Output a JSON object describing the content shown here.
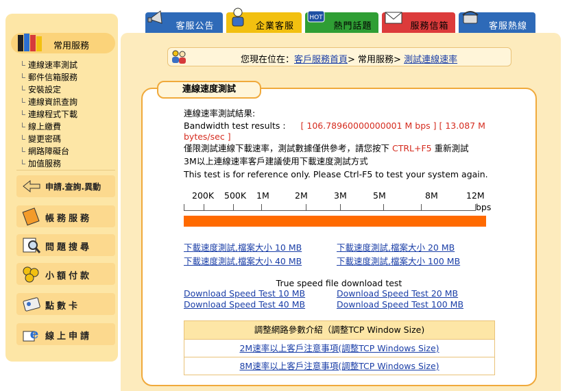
{
  "tabs": [
    {
      "label": "客服公告",
      "icon": "megaphone-icon",
      "color": "#2e6ab8"
    },
    {
      "label": "企業客服",
      "icon": "person-icon",
      "color": "#f2c010"
    },
    {
      "label": "熱門話題",
      "icon": "hot-icon",
      "color": "#2f9e34"
    },
    {
      "label": "服務信箱",
      "icon": "mail-icon",
      "color": "#dc3b3b"
    },
    {
      "label": "客服熱線",
      "icon": "telephone-icon",
      "color": "#2e6ab8"
    }
  ],
  "sidebar": {
    "heading": "常用服務",
    "items": [
      "連線速率測試",
      "郵件信箱服務",
      "安裝設定",
      "連線資訊查詢",
      "連線程式下載",
      "線上繳費",
      "變更密碼",
      "網路障礙台",
      "加值服務"
    ],
    "buttons": [
      "申請.查詢.異動",
      "帳務服務",
      "問題搜尋",
      "小額付款",
      "點數卡",
      "線上申請"
    ]
  },
  "breadcrumb": {
    "prefix": "您現在位在：",
    "home": "客戶服務首頁",
    "sep1": "> 常用服務> ",
    "current": "測試連線速率"
  },
  "card": {
    "title": "連線速度測試",
    "result_label": "連線速率測試結果:",
    "bandwidth_label": "Bandwidth test results :",
    "result_line1": "[ 106.78960000000001 M bps ] [ 13.087 M",
    "result_line2": "bytes/sec ]",
    "note_cn_prefix": "僅限測試連線下載速率，測試數據僅供參考，請您按下",
    "note_cn_key": "CTRL+F5",
    "note_cn_suffix": "重新測試",
    "note_cn2": "3M以上連線速率客戶建議使用下載速度測試方式",
    "note_en": "This test is for reference only. Please Ctrl-F5 to test your system again.",
    "scale_ticks": [
      "200K",
      "500K",
      "1M",
      "2M",
      "3M",
      "5M",
      "8M",
      "12M"
    ],
    "scale_unit": "bps",
    "speed_percent": 100,
    "bar_color": "#ff6a00"
  },
  "links_cn": [
    "下載速度測試,檔案大小 10 MB",
    "下載速度測試,檔案大小 20 MB",
    "下載速度測試,檔案大小 40 MB",
    "下載速度測試,檔案大小 100 MB"
  ],
  "links_caption": "True speed file download test",
  "links_en": [
    "Download Speed Test 10 MB",
    "Download Speed Test 20 MB",
    "Download Speed Test 40 MB",
    "Download Speed Test 100 MB"
  ],
  "tcp": {
    "header": "調整網路參數介紹（調整TCP Window Size)",
    "row1": "2M速率以上客戶注意事項(調整TCP Windows Size)",
    "row2": "8M速率以上客戶注意事項(調整TCP Windows Size)"
  }
}
